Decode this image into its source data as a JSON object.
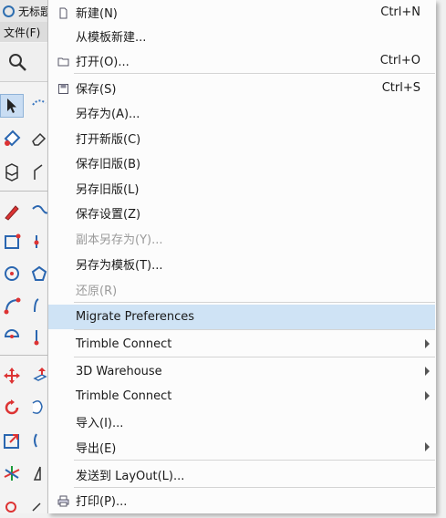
{
  "app": {
    "title": "无标题",
    "menu_file": "文件(F)"
  },
  "menu": {
    "items": [
      {
        "id": "new",
        "label": "新建(N)",
        "shortcut": "Ctrl+N",
        "icon": "new-file-icon",
        "disabled": false,
        "submenu": false
      },
      {
        "id": "new-from-template",
        "label": "从模板新建...",
        "shortcut": "",
        "icon": "",
        "disabled": false,
        "submenu": false
      },
      {
        "id": "open",
        "label": "打开(O)...",
        "shortcut": "Ctrl+O",
        "icon": "folder-icon",
        "disabled": false,
        "submenu": false
      },
      {
        "id": "save",
        "label": "保存(S)",
        "shortcut": "Ctrl+S",
        "icon": "save-icon",
        "disabled": false,
        "submenu": false
      },
      {
        "id": "save-as",
        "label": "另存为(A)...",
        "shortcut": "",
        "icon": "",
        "disabled": false,
        "submenu": false
      },
      {
        "id": "open-new-version",
        "label": "打开新版(C)",
        "shortcut": "",
        "icon": "",
        "disabled": false,
        "submenu": false
      },
      {
        "id": "save-old-version",
        "label": "保存旧版(B)",
        "shortcut": "",
        "icon": "",
        "disabled": false,
        "submenu": false
      },
      {
        "id": "save-as-old-version",
        "label": "另存旧版(L)",
        "shortcut": "",
        "icon": "",
        "disabled": false,
        "submenu": false
      },
      {
        "id": "save-settings",
        "label": "保存设置(Z)",
        "shortcut": "",
        "icon": "",
        "disabled": false,
        "submenu": false
      },
      {
        "id": "save-copy-as",
        "label": "副本另存为(Y)...",
        "shortcut": "",
        "icon": "",
        "disabled": true,
        "submenu": false
      },
      {
        "id": "save-as-template",
        "label": "另存为模板(T)...",
        "shortcut": "",
        "icon": "",
        "disabled": false,
        "submenu": false
      },
      {
        "id": "revert",
        "label": "还原(R)",
        "shortcut": "",
        "icon": "",
        "disabled": true,
        "submenu": false
      },
      {
        "id": "migrate-preferences",
        "label": "Migrate Preferences",
        "shortcut": "",
        "icon": "",
        "disabled": false,
        "submenu": false,
        "highlighted": true
      },
      {
        "id": "trimble-connect-1",
        "label": "Trimble Connect",
        "shortcut": "",
        "icon": "",
        "disabled": false,
        "submenu": true
      },
      {
        "id": "3d-warehouse",
        "label": "3D Warehouse",
        "shortcut": "",
        "icon": "",
        "disabled": false,
        "submenu": true
      },
      {
        "id": "trimble-connect-2",
        "label": "Trimble Connect",
        "shortcut": "",
        "icon": "",
        "disabled": false,
        "submenu": true
      },
      {
        "id": "import",
        "label": "导入(I)...",
        "shortcut": "",
        "icon": "",
        "disabled": false,
        "submenu": false
      },
      {
        "id": "export",
        "label": "导出(E)",
        "shortcut": "",
        "icon": "",
        "disabled": false,
        "submenu": true
      },
      {
        "id": "send-to-layout",
        "label": "发送到 LayOut(L)...",
        "shortcut": "",
        "icon": "",
        "disabled": false,
        "submenu": false
      },
      {
        "id": "print",
        "label": "打印(P)...",
        "shortcut": "",
        "icon": "printer-icon",
        "disabled": false,
        "submenu": false
      }
    ]
  }
}
